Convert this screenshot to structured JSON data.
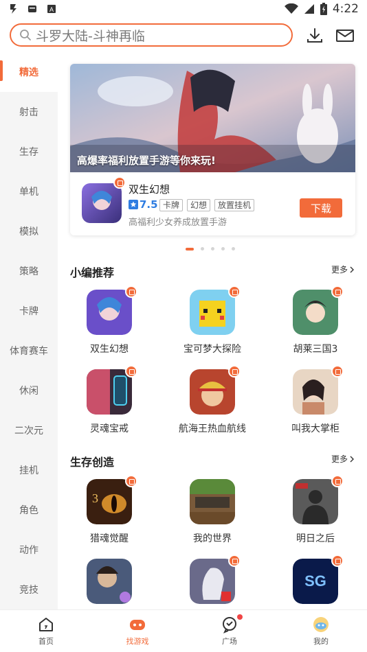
{
  "status_bar": {
    "time": "4:22"
  },
  "search": {
    "placeholder": "斗罗大陆-斗神再临",
    "icons": [
      "download-icon",
      "mail-icon"
    ]
  },
  "sidebar": {
    "items": [
      {
        "label": "精选",
        "active": true
      },
      {
        "label": "射击"
      },
      {
        "label": "生存"
      },
      {
        "label": "单机"
      },
      {
        "label": "模拟"
      },
      {
        "label": "策略"
      },
      {
        "label": "卡牌"
      },
      {
        "label": "体育赛车"
      },
      {
        "label": "休闲"
      },
      {
        "label": "二次元"
      },
      {
        "label": "挂机"
      },
      {
        "label": "角色"
      },
      {
        "label": "动作"
      },
      {
        "label": "竞技"
      }
    ]
  },
  "banner": {
    "caption": "高爆率福利放置手游等你来玩!",
    "game": {
      "name": "双生幻想",
      "score": "7.5",
      "tags": [
        "卡牌",
        "幻想",
        "放置挂机"
      ],
      "description": "高福利少女养成放置手游",
      "download_label": "下载"
    },
    "carousel_pages": 5,
    "carousel_active": 0
  },
  "sections": [
    {
      "title": "小编推荐",
      "more_label": "更多",
      "games": [
        {
          "name": "双生幻想",
          "color": "#6a4fc9"
        },
        {
          "name": "宝可梦大探险",
          "color": "#f5d21f"
        },
        {
          "name": "胡莱三国3",
          "color": "#4f8f6a"
        },
        {
          "name": "灵魂宝戒",
          "color": "#c9506a"
        },
        {
          "name": "航海王热血航线",
          "color": "#b8452e"
        },
        {
          "name": "叫我大掌柜",
          "color": "#c98a6a"
        }
      ]
    },
    {
      "title": "生存创造",
      "more_label": "更多",
      "games": [
        {
          "name": "猎魂觉醒",
          "color": "#6b3a1e"
        },
        {
          "name": "我的世界",
          "color": "#5a8a3a"
        },
        {
          "name": "明日之后",
          "color": "#3e3e3e"
        },
        {
          "name": "",
          "color": "#4a5a7a"
        },
        {
          "name": "",
          "color": "#6a6a8a"
        },
        {
          "name": "",
          "color": "#1a3a8a"
        }
      ]
    }
  ],
  "bottom_nav": [
    {
      "label": "首页",
      "icon": "home-icon"
    },
    {
      "label": "找游戏",
      "icon": "gamepad-icon",
      "active": true
    },
    {
      "label": "广场",
      "icon": "chat-bubble-icon",
      "badge": true
    },
    {
      "label": "我的",
      "icon": "profile-icon"
    }
  ],
  "colors": {
    "accent": "#f26b3a",
    "score": "#2f7de1",
    "sidebar_bg": "#f5f5f5"
  }
}
